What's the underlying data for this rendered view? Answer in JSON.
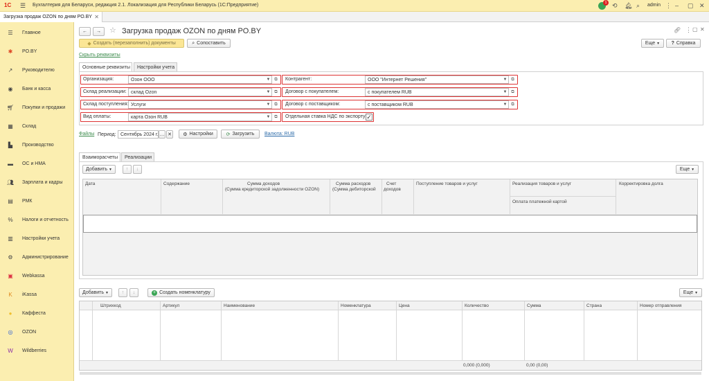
{
  "titlebar": {
    "app_title": "Бухгалтерия для Беларуси, редакция 2.1. Локализация для Республики Беларусь (1С:Предприятие)",
    "notification_count": "1",
    "user": "admin"
  },
  "tab": {
    "label": "Загрузка продаж OZON по дням PO.BY"
  },
  "sidebar": {
    "items": [
      {
        "label": "Главное",
        "icon": "menu-icon"
      },
      {
        "label": "PO.BY",
        "icon": "star-icon"
      },
      {
        "label": "Руководителю",
        "icon": "chart-icon"
      },
      {
        "label": "Банк и касса",
        "icon": "bank-icon"
      },
      {
        "label": "Покупки и продажи",
        "icon": "cart-icon"
      },
      {
        "label": "Склад",
        "icon": "warehouse-icon"
      },
      {
        "label": "Производство",
        "icon": "factory-icon"
      },
      {
        "label": "ОС и НМА",
        "icon": "truck-icon"
      },
      {
        "label": "Зарплата и кадры",
        "icon": "people-icon"
      },
      {
        "label": "РМК",
        "icon": "register-icon"
      },
      {
        "label": "Налоги и отчетность",
        "icon": "tax-icon"
      },
      {
        "label": "Настройки учета",
        "icon": "docs-icon"
      },
      {
        "label": "Администрирование",
        "icon": "gear-icon"
      },
      {
        "label": "Webkassa",
        "icon": "webkassa-icon"
      },
      {
        "label": "iKassa",
        "icon": "ikassa-icon"
      },
      {
        "label": "Каффеста",
        "icon": "kaffesta-icon"
      },
      {
        "label": "OZON",
        "icon": "ozon-icon"
      },
      {
        "label": "Wildberries",
        "icon": "wildberries-icon"
      }
    ]
  },
  "doc": {
    "title": "Загрузка продаж OZON по дням PO.BY",
    "create_button": "Создать (перезаполнить) документы",
    "compare_button": "Сопоставить",
    "more_button": "Еще",
    "help_button": "Справка",
    "hide_link": "Скрыть реквизиты"
  },
  "tabs": [
    "Основные реквизиты",
    "Настройки учета"
  ],
  "form": {
    "organization_label": "Организация:",
    "organization_value": "Озон ООО",
    "sales_warehouse_label": "Склад реализации:",
    "sales_warehouse_value": "склад Ozon",
    "receipt_warehouse_label": "Склад поступления:",
    "receipt_warehouse_value": "Услуги",
    "payment_label": "Вид оплаты:",
    "payment_value": "карта Озон RUB",
    "counterparty_label": "Контрагент:",
    "counterparty_value": "ООО \"Интернет Решения\"",
    "buyer_contract_label": "Договор с покупателем:",
    "buyer_contract_value": "с покупателем RUB",
    "supplier_contract_label": "Договор с поставщиком:",
    "supplier_contract_value": "с поставщиком RUB",
    "vat_label": "Отдельная ставка НДС по экспорту:"
  },
  "period_row": {
    "files_link": "Файлы",
    "period_label": "Период:",
    "period_value": "Сентябрь 2024 г.",
    "settings_button": "Настройки",
    "load_button": "Загрузить",
    "currency_link": "Валюта: RUB"
  },
  "lower_tabs": [
    "Взаиморасчеты",
    "Реализации"
  ],
  "settlements": {
    "add_button": "Добавить",
    "more_button": "Еще",
    "columns": {
      "date": "Дата",
      "content": "Содержание",
      "income": "Сумма доходов",
      "income_sub": "(Сумма кредиторской задолженности OZON)",
      "expense": "Сумма расходов",
      "expense_sub": "(Сумма дебиторской",
      "account": "Счет",
      "account_sub": "доходов",
      "receipt": "Поступление товаров и услуг",
      "sales": "Реализация товаров и услуг",
      "card_payment": "Оплата платежной картой",
      "correction": "Корректировка долга"
    }
  },
  "goods": {
    "add_button": "Добавить",
    "create_nomenclature_button": "Создать номенклатуру",
    "more_button": "Еще",
    "columns": [
      "Штрихкод",
      "Артикул",
      "Наименование",
      "Номенклатура",
      "Цена",
      "Количество",
      "Сумма",
      "Страна",
      "Номер отправления"
    ],
    "total_quantity": "0,000 (0,000)",
    "total_sum": "0,00 (0,00)"
  },
  "colors": {
    "accent_yellow": "#fbeeb0",
    "highlight_red": "#d33333",
    "link_blue": "#2b6aa8"
  }
}
